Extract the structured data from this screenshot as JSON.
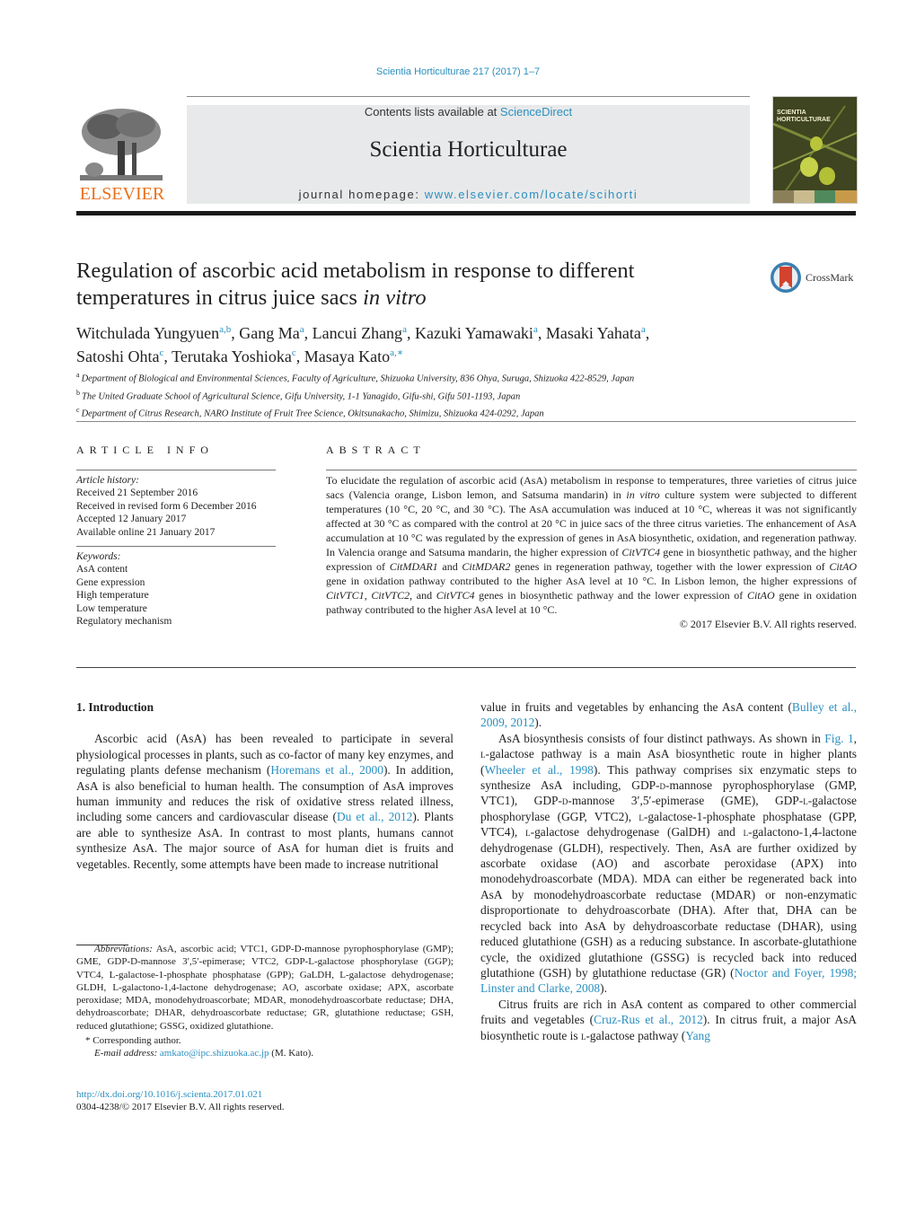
{
  "header": {
    "journal_citation": "Scientia Horticulturae 217 (2017) 1–7",
    "contents_prefix": "Contents lists available at ",
    "contents_link": "ScienceDirect",
    "journal_title": "Scientia Horticulturae",
    "homepage_prefix": "journal homepage: ",
    "homepage_link": "www.elsevier.com/locate/scihorti",
    "publisher": "ELSEVIER",
    "cover_title_line1": "SCIENTIA",
    "cover_title_line2": "HORTICULTURAE",
    "colors": {
      "link": "#2a8fc0",
      "elsevier_orange": "#e9711c",
      "banner_gray": "#e8e9ea"
    }
  },
  "article": {
    "title_plain": "Regulation of ascorbic acid metabolism in response to different temperatures in citrus juice sacs ",
    "title_italic": "in vitro",
    "crossmark_label": "CrossMark",
    "authors": [
      {
        "name": "Witchulada Yungyuen",
        "sup": "a,b",
        "sep": ", "
      },
      {
        "name": "Gang Ma",
        "sup": "a",
        "sep": ", "
      },
      {
        "name": "Lancui Zhang",
        "sup": "a",
        "sep": ", "
      },
      {
        "name": "Kazuki Yamawaki",
        "sup": "a",
        "sep": ", "
      },
      {
        "name": "Masaki Yahata",
        "sup": "a",
        "sep": ","
      },
      {
        "name": "Satoshi Ohta",
        "sup": "c",
        "sep": ", "
      },
      {
        "name": "Terutaka Yoshioka",
        "sup": "c",
        "sep": ", "
      },
      {
        "name": "Masaya Kato",
        "sup": "a,∗",
        "sep": ""
      }
    ],
    "affiliations": [
      {
        "mark": "a",
        "text": "Department of Biological and Environmental Sciences, Faculty of Agriculture, Shizuoka University, 836 Ohya, Suruga, Shizuoka 422-8529, Japan"
      },
      {
        "mark": "b",
        "text": "The United Graduate School of Agricultural Science, Gifu University, 1-1 Yanagido, Gifu-shi, Gifu 501-1193, Japan"
      },
      {
        "mark": "c",
        "text": "Department of Citrus Research, NARO Institute of Fruit Tree Science, Okitsunakacho, Shimizu, Shizuoka 424-0292, Japan"
      }
    ]
  },
  "article_info": {
    "heading": "ARTICLE INFO",
    "history_label": "Article history:",
    "history": [
      "Received 21 September 2016",
      "Received in revised form 6 December 2016",
      "Accepted 12 January 2017",
      "Available online 21 January 2017"
    ],
    "keywords_label": "Keywords:",
    "keywords": [
      "AsA content",
      "Gene expression",
      "High temperature",
      "Low temperature",
      "Regulatory mechanism"
    ]
  },
  "abstract": {
    "heading": "ABSTRACT",
    "s1": "To elucidate the regulation of ascorbic acid (AsA) metabolism in response to temperatures, three varieties of citrus juice sacs (Valencia orange, Lisbon lemon, and Satsuma mandarin) in ",
    "s1_italic": "in vitro",
    "s2": " culture system were subjected to different temperatures (10 °C, 20 °C, and 30 °C). The AsA accumulation was induced at 10 °C, whereas it was not significantly affected at 30 °C as compared with the control at 20 °C in juice sacs of the three citrus varieties. The enhancement of AsA accumulation at 10 °C was regulated by the expression of genes in AsA biosynthetic, oxidation, and regeneration pathway. In Valencia orange and Satsuma mandarin, the higher expression of ",
    "g1": "CitVTC4",
    "s3": " gene in biosynthetic pathway, and the higher expression of ",
    "g2": "CitMDAR1",
    "s4": " and ",
    "g3": "CitMDAR2",
    "s5": " genes in regeneration pathway, together with the lower expression of ",
    "g4": "CitAO",
    "s6": " gene in oxidation pathway contributed to the higher AsA level at 10 °C. In Lisbon lemon, the higher expressions of ",
    "g5": "CitVTC1",
    "s7": ", ",
    "g6": "CitVTC2",
    "s8": ", and ",
    "g7": "CitVTC4",
    "s9": " genes in biosynthetic pathway and the lower expression of ",
    "g8": "CitAO",
    "s10": " gene in oxidation pathway contributed to the higher AsA level at 10 °C.",
    "copyright": "© 2017 Elsevier B.V. All rights reserved."
  },
  "intro": {
    "heading": "1.  Introduction",
    "p1_a": "Ascorbic acid (AsA) has been revealed to participate in several physiological processes in plants, such as co-factor of many key enzymes, and regulating plants defense mechanism (",
    "p1_ref1": "Horemans et al., 2000",
    "p1_b": "). In addition, AsA is also beneficial to human health. The consumption of AsA improves human immunity and reduces the risk of oxidative stress related illness, including some cancers and cardiovascular disease (",
    "p1_ref2": "Du et al., 2012",
    "p1_c": "). Plants are able to synthesize AsA. In contrast to most plants, humans cannot synthesize AsA. The major source of AsA for human diet is fruits and vegetables. Recently, some attempts have been made to increase nutritional",
    "p1_cont": "value in fruits and vegetables by enhancing the AsA content (",
    "p1_ref3": "Bulley et al., 2009, 2012",
    "p1_end": ").",
    "p2_a": "AsA biosynthesis consists of four distinct pathways. As shown in ",
    "p2_ref1": "Fig. 1",
    "p2_b": ", ",
    "p2_sc1": "l",
    "p2_c": "-galactose pathway is a main AsA biosynthetic route in higher plants (",
    "p2_ref2": "Wheeler et al., 1998",
    "p2_d": "). This pathway comprises six enzymatic steps to synthesize AsA including, GDP-",
    "p2_sc2": "d",
    "p2_e": "-mannose pyrophosphorylase (GMP, VTC1), GDP-",
    "p2_sc3": "d",
    "p2_f": "-mannose 3′,5′-epimerase (GME), GDP-",
    "p2_sc4": "l",
    "p2_g": "-galactose phosphorylase (GGP, VTC2), ",
    "p2_sc5": "l",
    "p2_h": "-galactose-1-phosphate phosphatase (GPP, VTC4), ",
    "p2_sc6": "l",
    "p2_i": "-galactose dehydrogenase (GalDH) and ",
    "p2_sc7": "l",
    "p2_j": "-galactono-1,4-lactone dehydrogenase (GLDH), respectively. Then, AsA are further oxidized by ascorbate oxidase (AO) and ascorbate peroxidase (APX) into monodehydroascorbate (MDA). MDA can either be regenerated back into AsA by monodehydroascorbate reductase (MDAR) or non-enzymatic disproportionate to dehydroascorbate (DHA). After that, DHA can be recycled back into AsA by dehydroascorbate reductase (DHAR), using reduced glutathione (GSH) as a reducing substance. In ascorbate-glutathione cycle, the oxidized glutathione (GSSG) is recycled back into reduced glutathione (GSH) by glutathione reductase (GR) (",
    "p2_ref3": "Noctor and Foyer, 1998; Linster and Clarke, 2008",
    "p2_k": ").",
    "p3_a": "Citrus fruits are rich in AsA content as compared to other commercial fruits and vegetables (",
    "p3_ref1": "Cruz-Rus et al., 2012",
    "p3_b": "). In citrus fruit, a major AsA biosynthetic route is ",
    "p3_sc1": "l",
    "p3_c": "-galactose pathway (",
    "p3_ref2": "Yang"
  },
  "footnotes": {
    "abbr_label": "Abbreviations:",
    "abbr_text": "  AsA, ascorbic acid; VTC1, GDP-D-mannose pyrophosphorylase (GMP); GME, GDP-D-mannose 3′,5′-epimerase; VTC2, GDP-L-galactose phosphorylase (GGP); VTC4, L-galactose-1-phosphate phosphatase (GPP); GaLDH, L-galactose dehydrogenase; GLDH, L-galactono-1,4-lactone dehydrogenase; AO, ascorbate oxidase; APX, ascorbate peroxidase; MDA, monodehydroascorbate; MDAR, monodehydroascorbate reductase; DHA, dehydroascorbate; DHAR, dehydroascorbate reductase; GR, glutathione reductase; GSH, reduced glutathione; GSSG, oxidized glutathione.",
    "corresponding_mark": "*",
    "corresponding_text": " Corresponding author.",
    "email_label": "E-mail address:",
    "email": "amkato@ipc.shizuoka.ac.jp",
    "email_suffix": " (M. Kato).",
    "doi": "http://dx.doi.org/10.1016/j.scienta.2017.01.021",
    "issn_line": "0304-4238/© 2017 Elsevier B.V. All rights reserved."
  }
}
